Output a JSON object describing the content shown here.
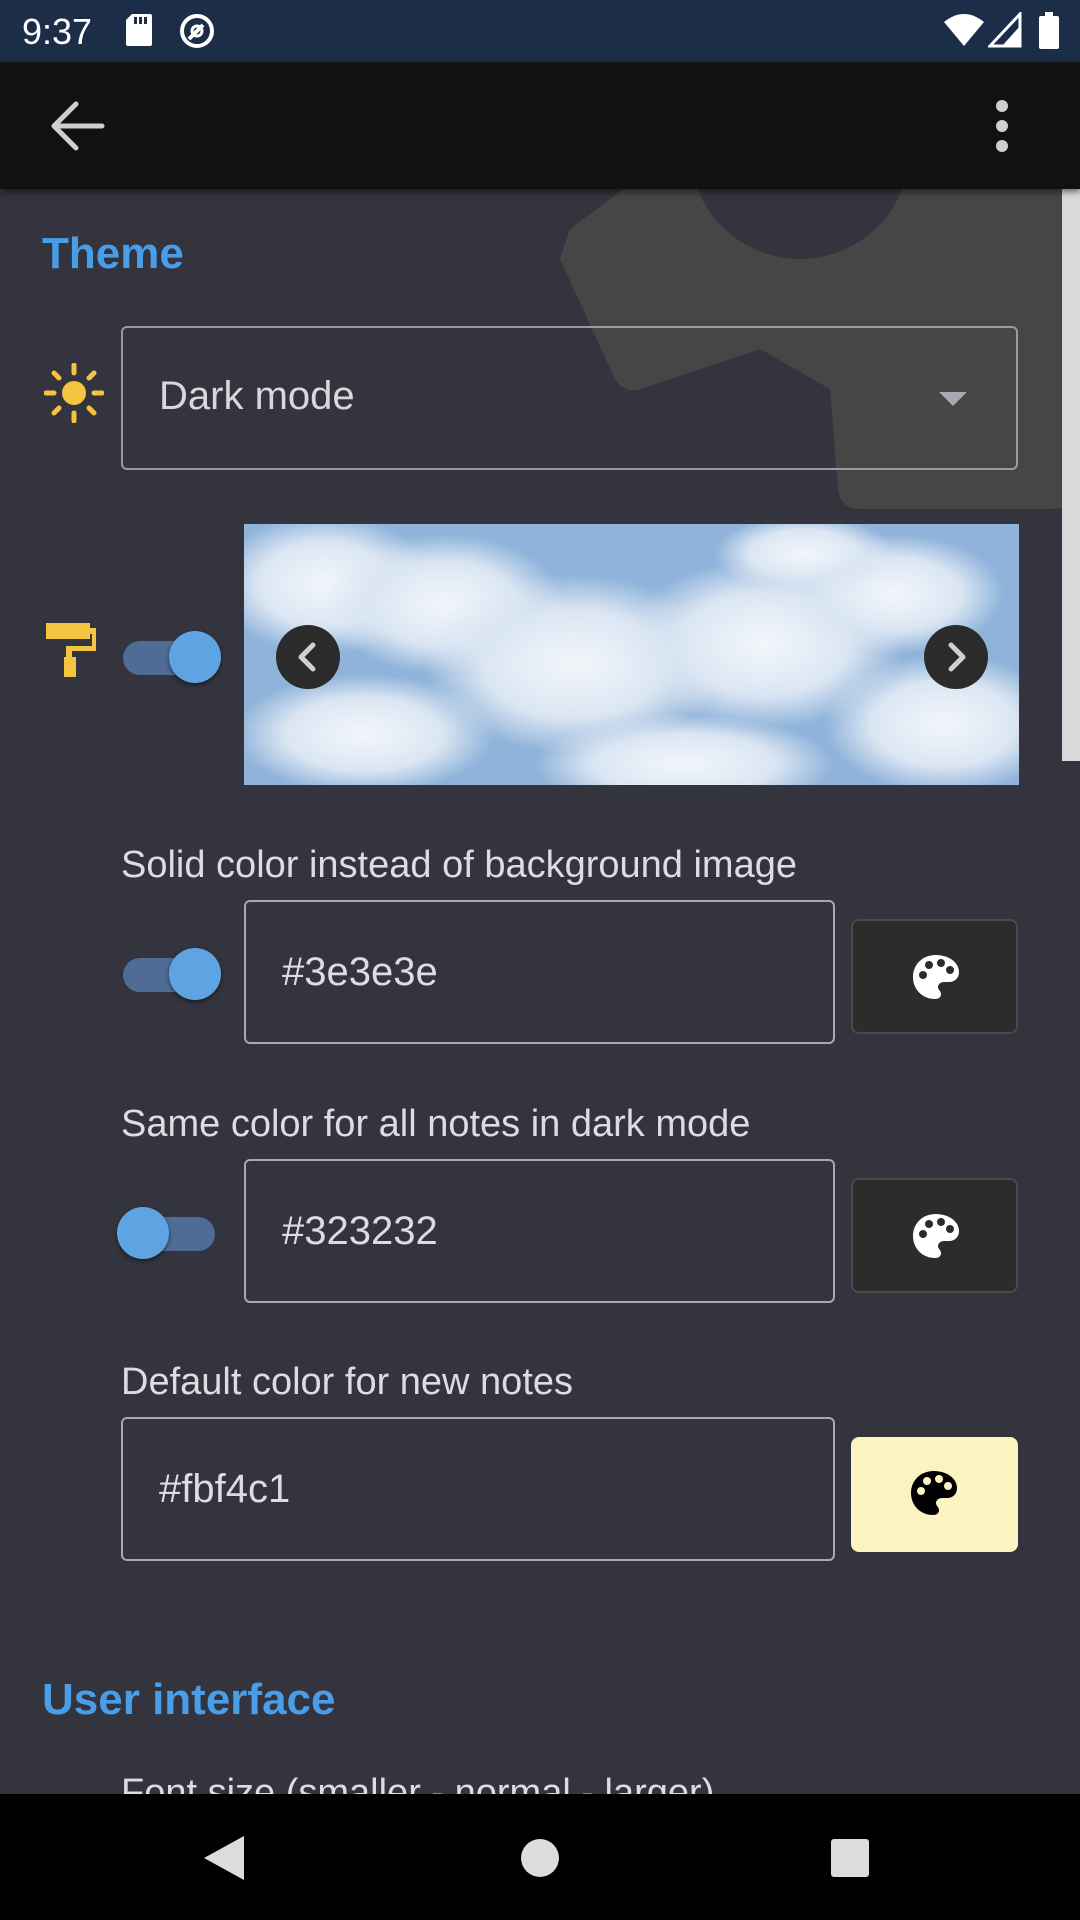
{
  "status_bar": {
    "time": "9:37",
    "icons": [
      "sd-card-icon",
      "vpn-icon",
      "wifi-icon",
      "signal-icon",
      "battery-icon"
    ]
  },
  "app_bar": {
    "icons": [
      "back-arrow-icon",
      "overflow-menu-icon"
    ]
  },
  "theme_section": {
    "title": "Theme",
    "mode_icon": "sun-icon",
    "mode_dropdown": {
      "selected": "Dark mode"
    },
    "background_image": {
      "icon": "paint-roller-icon",
      "toggle_on": true,
      "image": "clouds-sky"
    },
    "solid_color": {
      "label": "Solid color instead of background image",
      "toggle_on": true,
      "value": "#3e3e3e"
    },
    "same_color_dark": {
      "label": "Same color for all notes in dark mode",
      "toggle_on": false,
      "value": "#323232"
    },
    "default_note_color": {
      "label": "Default color for new notes",
      "value": "#fbf4c1"
    }
  },
  "user_interface_section": {
    "title": "User interface",
    "font_size_label": "Font size (smaller - normal - larger)"
  },
  "colors": {
    "accent": "#4a9ee8",
    "background": "#34343e",
    "icon_yellow": "#f5c542",
    "default_note_swatch": "#fbf4c1"
  }
}
